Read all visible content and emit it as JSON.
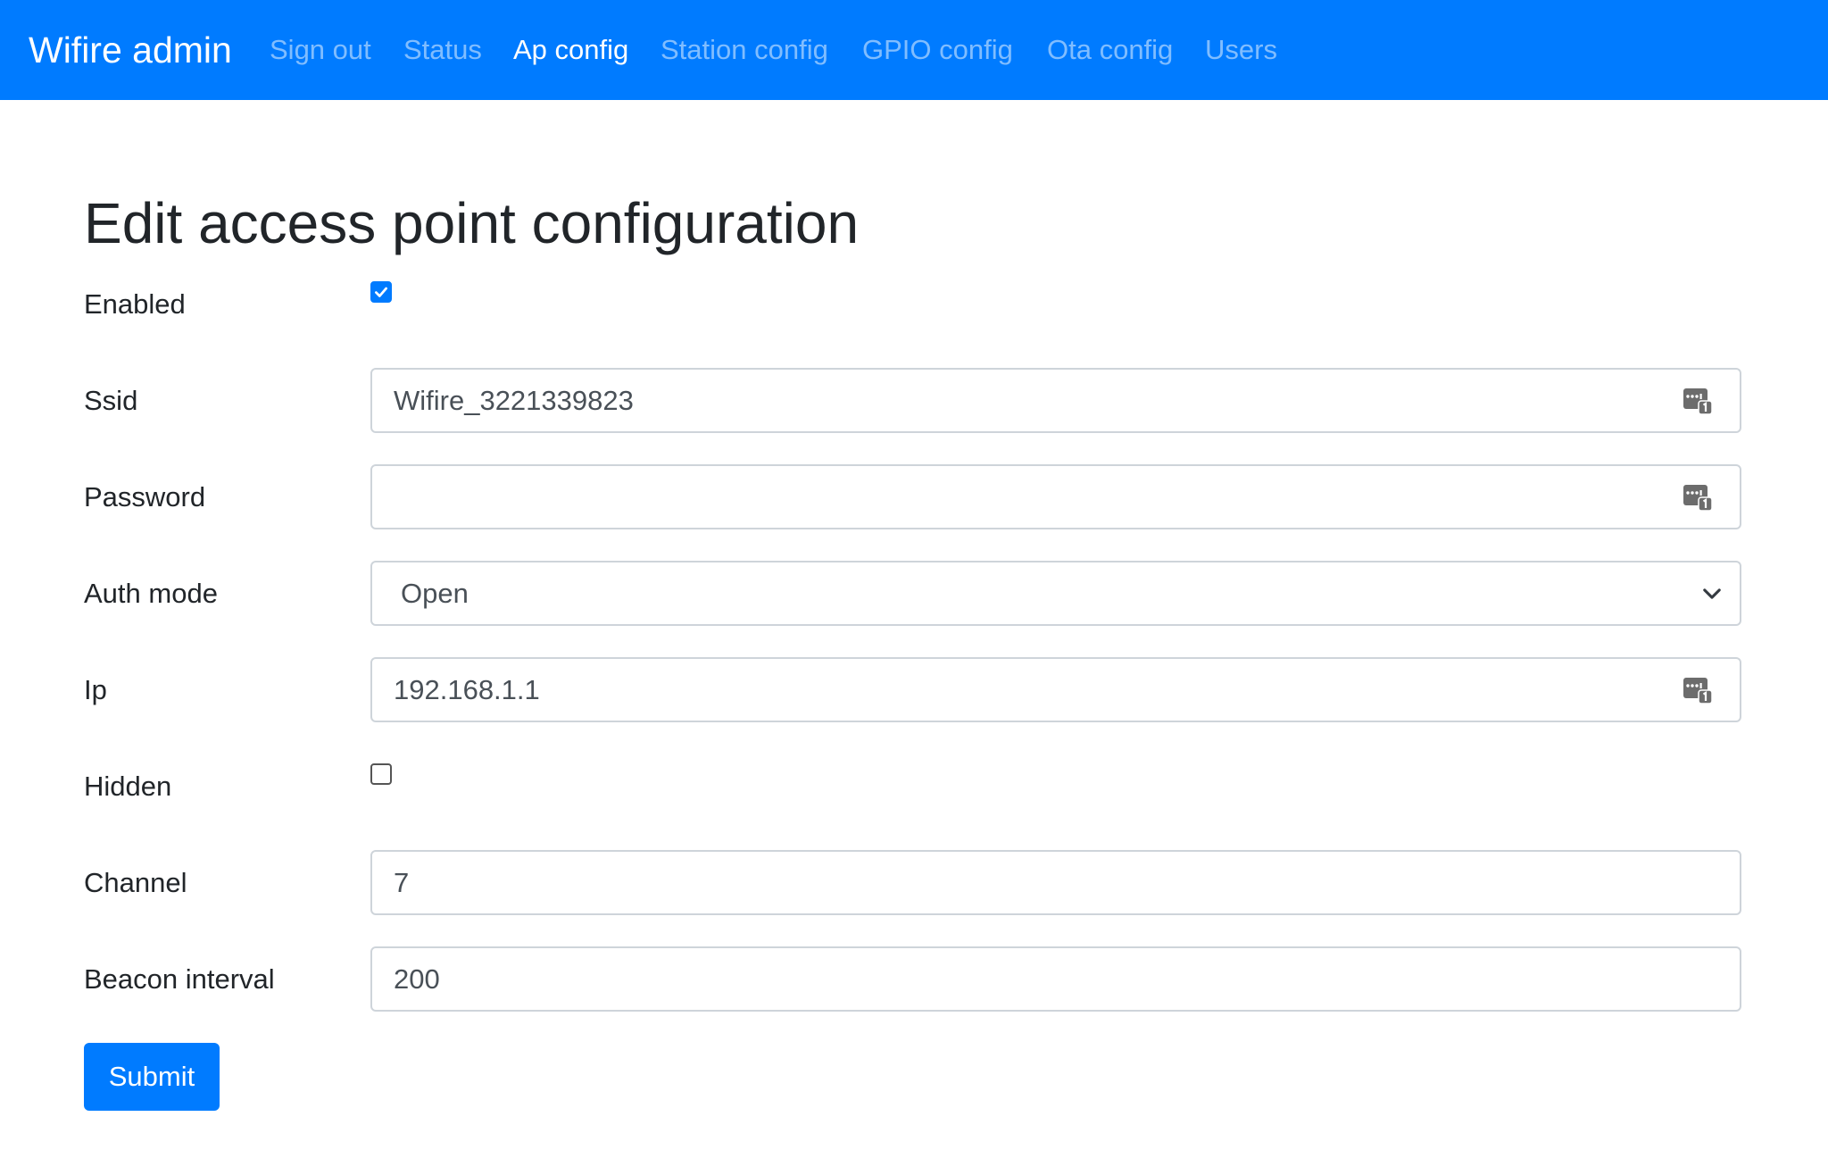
{
  "navbar": {
    "brand": "Wifire admin",
    "links": [
      {
        "label": "Sign out",
        "active": false
      },
      {
        "label": "Status",
        "active": false
      },
      {
        "label": "Ap config",
        "active": true
      },
      {
        "label": "Station config",
        "active": false
      },
      {
        "label": "GPIO config",
        "active": false
      },
      {
        "label": "Ota config",
        "active": false
      },
      {
        "label": "Users",
        "active": false
      }
    ],
    "background_color": "#007bff"
  },
  "form": {
    "title": "Edit access point configuration",
    "enabled": {
      "label": "Enabled",
      "checked": true
    },
    "ssid": {
      "label": "Ssid",
      "value": "Wifire_3221339823",
      "icon": "password-manager-icon"
    },
    "password": {
      "label": "Password",
      "value": "",
      "icon": "password-manager-icon"
    },
    "auth_mode": {
      "label": "Auth mode",
      "selected": "Open",
      "icon": "chevron-down-icon"
    },
    "ip": {
      "label": "Ip",
      "value": "192.168.1.1",
      "icon": "password-manager-icon"
    },
    "hidden": {
      "label": "Hidden",
      "checked": false
    },
    "channel": {
      "label": "Channel",
      "value": "7"
    },
    "beacon_interval": {
      "label": "Beacon interval",
      "value": "200"
    },
    "submit_label": "Submit"
  },
  "colors": {
    "primary": "#007bff",
    "text": "#212529",
    "input_text": "#495057",
    "border": "#ced4da"
  }
}
